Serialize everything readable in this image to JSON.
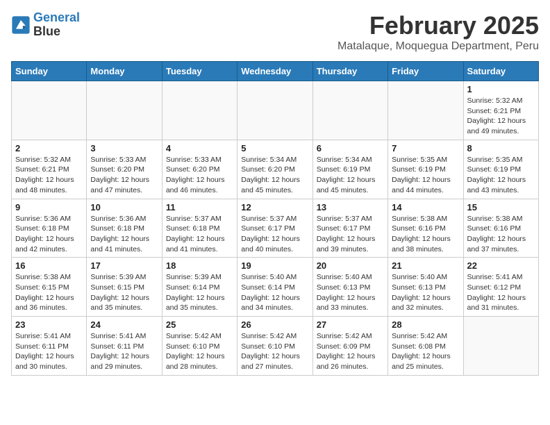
{
  "header": {
    "logo_line1": "General",
    "logo_line2": "Blue",
    "month_title": "February 2025",
    "location": "Matalaque, Moquegua Department, Peru"
  },
  "days_of_week": [
    "Sunday",
    "Monday",
    "Tuesday",
    "Wednesday",
    "Thursday",
    "Friday",
    "Saturday"
  ],
  "weeks": [
    [
      {
        "day": "",
        "info": ""
      },
      {
        "day": "",
        "info": ""
      },
      {
        "day": "",
        "info": ""
      },
      {
        "day": "",
        "info": ""
      },
      {
        "day": "",
        "info": ""
      },
      {
        "day": "",
        "info": ""
      },
      {
        "day": "1",
        "info": "Sunrise: 5:32 AM\nSunset: 6:21 PM\nDaylight: 12 hours and 49 minutes."
      }
    ],
    [
      {
        "day": "2",
        "info": "Sunrise: 5:32 AM\nSunset: 6:21 PM\nDaylight: 12 hours and 48 minutes."
      },
      {
        "day": "3",
        "info": "Sunrise: 5:33 AM\nSunset: 6:20 PM\nDaylight: 12 hours and 47 minutes."
      },
      {
        "day": "4",
        "info": "Sunrise: 5:33 AM\nSunset: 6:20 PM\nDaylight: 12 hours and 46 minutes."
      },
      {
        "day": "5",
        "info": "Sunrise: 5:34 AM\nSunset: 6:20 PM\nDaylight: 12 hours and 45 minutes."
      },
      {
        "day": "6",
        "info": "Sunrise: 5:34 AM\nSunset: 6:19 PM\nDaylight: 12 hours and 45 minutes."
      },
      {
        "day": "7",
        "info": "Sunrise: 5:35 AM\nSunset: 6:19 PM\nDaylight: 12 hours and 44 minutes."
      },
      {
        "day": "8",
        "info": "Sunrise: 5:35 AM\nSunset: 6:19 PM\nDaylight: 12 hours and 43 minutes."
      }
    ],
    [
      {
        "day": "9",
        "info": "Sunrise: 5:36 AM\nSunset: 6:18 PM\nDaylight: 12 hours and 42 minutes."
      },
      {
        "day": "10",
        "info": "Sunrise: 5:36 AM\nSunset: 6:18 PM\nDaylight: 12 hours and 41 minutes."
      },
      {
        "day": "11",
        "info": "Sunrise: 5:37 AM\nSunset: 6:18 PM\nDaylight: 12 hours and 41 minutes."
      },
      {
        "day": "12",
        "info": "Sunrise: 5:37 AM\nSunset: 6:17 PM\nDaylight: 12 hours and 40 minutes."
      },
      {
        "day": "13",
        "info": "Sunrise: 5:37 AM\nSunset: 6:17 PM\nDaylight: 12 hours and 39 minutes."
      },
      {
        "day": "14",
        "info": "Sunrise: 5:38 AM\nSunset: 6:16 PM\nDaylight: 12 hours and 38 minutes."
      },
      {
        "day": "15",
        "info": "Sunrise: 5:38 AM\nSunset: 6:16 PM\nDaylight: 12 hours and 37 minutes."
      }
    ],
    [
      {
        "day": "16",
        "info": "Sunrise: 5:38 AM\nSunset: 6:15 PM\nDaylight: 12 hours and 36 minutes."
      },
      {
        "day": "17",
        "info": "Sunrise: 5:39 AM\nSunset: 6:15 PM\nDaylight: 12 hours and 35 minutes."
      },
      {
        "day": "18",
        "info": "Sunrise: 5:39 AM\nSunset: 6:14 PM\nDaylight: 12 hours and 35 minutes."
      },
      {
        "day": "19",
        "info": "Sunrise: 5:40 AM\nSunset: 6:14 PM\nDaylight: 12 hours and 34 minutes."
      },
      {
        "day": "20",
        "info": "Sunrise: 5:40 AM\nSunset: 6:13 PM\nDaylight: 12 hours and 33 minutes."
      },
      {
        "day": "21",
        "info": "Sunrise: 5:40 AM\nSunset: 6:13 PM\nDaylight: 12 hours and 32 minutes."
      },
      {
        "day": "22",
        "info": "Sunrise: 5:41 AM\nSunset: 6:12 PM\nDaylight: 12 hours and 31 minutes."
      }
    ],
    [
      {
        "day": "23",
        "info": "Sunrise: 5:41 AM\nSunset: 6:11 PM\nDaylight: 12 hours and 30 minutes."
      },
      {
        "day": "24",
        "info": "Sunrise: 5:41 AM\nSunset: 6:11 PM\nDaylight: 12 hours and 29 minutes."
      },
      {
        "day": "25",
        "info": "Sunrise: 5:42 AM\nSunset: 6:10 PM\nDaylight: 12 hours and 28 minutes."
      },
      {
        "day": "26",
        "info": "Sunrise: 5:42 AM\nSunset: 6:10 PM\nDaylight: 12 hours and 27 minutes."
      },
      {
        "day": "27",
        "info": "Sunrise: 5:42 AM\nSunset: 6:09 PM\nDaylight: 12 hours and 26 minutes."
      },
      {
        "day": "28",
        "info": "Sunrise: 5:42 AM\nSunset: 6:08 PM\nDaylight: 12 hours and 25 minutes."
      },
      {
        "day": "",
        "info": ""
      }
    ]
  ]
}
